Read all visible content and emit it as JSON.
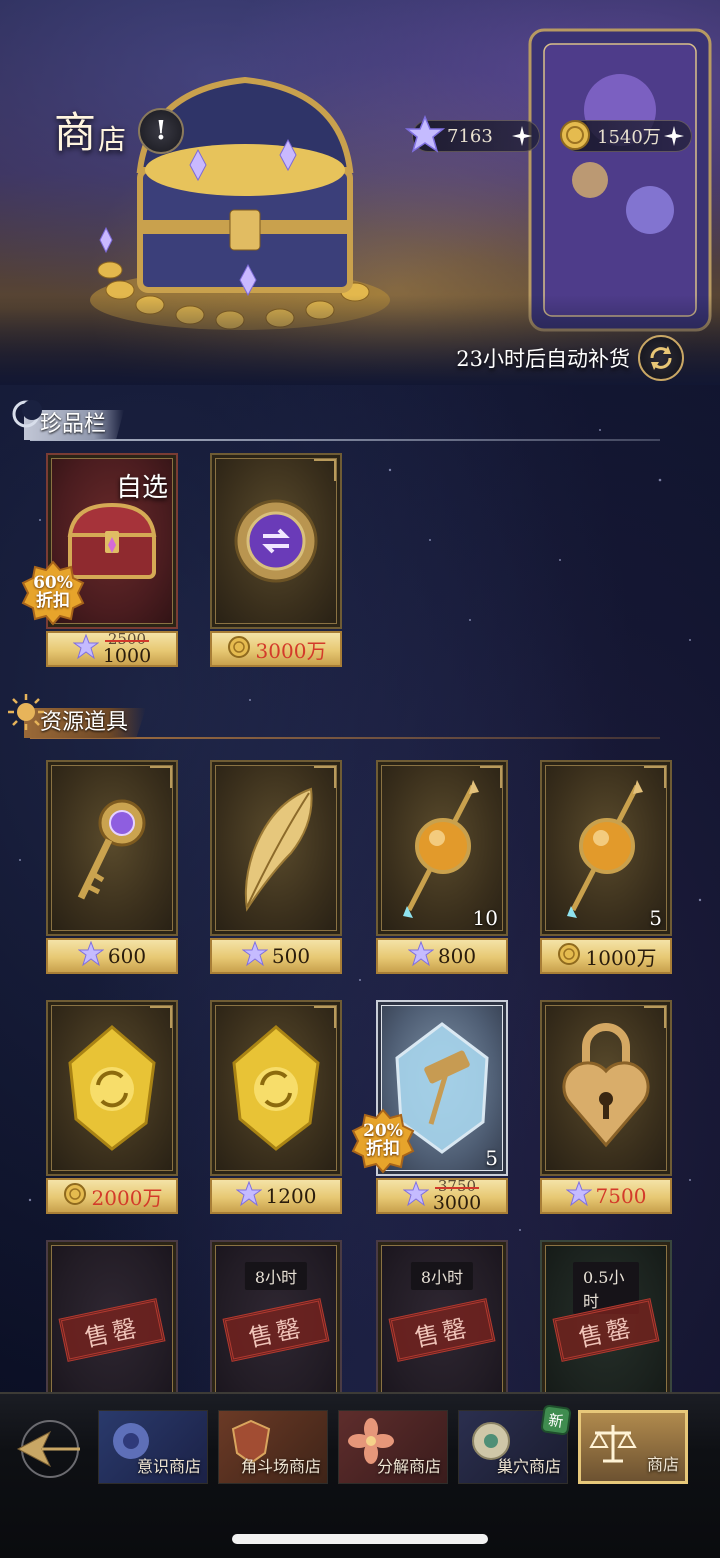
{
  "header": {
    "title_main": "商",
    "title_rest": "店",
    "currencies": [
      {
        "icon": "star-crystal-icon",
        "value": "7163"
      },
      {
        "icon": "gold-coin-icon",
        "value": "1540万"
      }
    ],
    "restock_text": "23小时后自动补货"
  },
  "sections": {
    "treasure": "珍品栏",
    "resources": "资源道具"
  },
  "treasure_items": [
    {
      "name": "chest",
      "label": "自选",
      "discount_pct": "60%",
      "discount_word": "折扣",
      "currency": "star-crystal-icon",
      "old_price": "2500",
      "price": "1000"
    },
    {
      "name": "purple-token",
      "currency": "gold-coin-icon",
      "price": "3000万",
      "price_color": "#d33a2a"
    }
  ],
  "resource_items": [
    {
      "name": "key",
      "currency": "star-crystal-icon",
      "price": "600"
    },
    {
      "name": "feather",
      "currency": "star-crystal-icon",
      "price": "500"
    },
    {
      "name": "potion-scepter",
      "qty": "10",
      "currency": "star-crystal-icon",
      "price": "800"
    },
    {
      "name": "potion-scepter",
      "qty": "5",
      "currency": "gold-coin-icon",
      "price": "1000万"
    },
    {
      "name": "refresh-crystal",
      "currency": "gold-coin-icon",
      "price": "2000万",
      "price_color": "#d33a2a"
    },
    {
      "name": "refresh-crystal",
      "currency": "star-crystal-icon",
      "price": "1200"
    },
    {
      "name": "hammer-crystal",
      "qty": "5",
      "discount_pct": "20%",
      "discount_word": "折扣",
      "currency": "star-crystal-icon",
      "old_price": "3750",
      "price": "3000"
    },
    {
      "name": "heart-lock",
      "currency": "star-crystal-icon",
      "price": "7500",
      "price_color": "#d33a2a"
    }
  ],
  "soldout_items": [
    {
      "soldout_text": "售罄"
    },
    {
      "timer": "8小时",
      "soldout_text": "售罄"
    },
    {
      "timer": "8小时",
      "soldout_text": "售罄"
    },
    {
      "timer": "0.5小时",
      "soldout_text": "售罄"
    }
  ],
  "nav": {
    "tabs": [
      {
        "label": "意识商店"
      },
      {
        "label": "角斗场商店"
      },
      {
        "label": "分解商店"
      },
      {
        "label": "巢穴商店",
        "badge": "新"
      },
      {
        "label": "商店",
        "active": true
      }
    ]
  },
  "colors": {
    "accent_gold": "#e7c873",
    "price_red": "#d33a2a",
    "bg": "#0b1022"
  }
}
